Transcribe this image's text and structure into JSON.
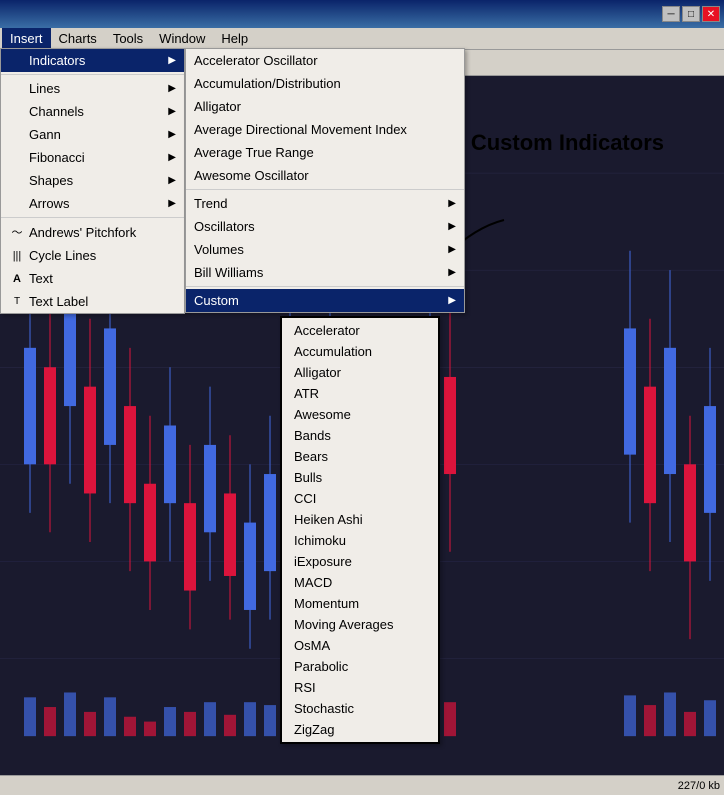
{
  "titlebar": {
    "minimize_label": "─",
    "maximize_label": "□",
    "close_label": "✕"
  },
  "menubar": {
    "items": [
      {
        "label": "Insert",
        "id": "insert",
        "active": true
      },
      {
        "label": "Charts",
        "id": "charts"
      },
      {
        "label": "Tools",
        "id": "tools"
      },
      {
        "label": "Window",
        "id": "window"
      },
      {
        "label": "Help",
        "id": "help"
      }
    ]
  },
  "insert_menu": {
    "items": [
      {
        "label": "Indicators",
        "id": "indicators",
        "has_arrow": true,
        "active": true
      },
      {
        "label": "Lines",
        "id": "lines",
        "has_arrow": true
      },
      {
        "label": "Channels",
        "id": "channels",
        "has_arrow": true
      },
      {
        "label": "Gann",
        "id": "gann",
        "has_arrow": true
      },
      {
        "label": "Fibonacci",
        "id": "fibonacci",
        "has_arrow": true
      },
      {
        "label": "Shapes",
        "id": "shapes",
        "has_arrow": true
      },
      {
        "label": "Arrows",
        "id": "arrows",
        "has_arrow": true
      },
      {
        "sep": true
      },
      {
        "label": "Andrews' Pitchfork",
        "id": "pitchfork",
        "icon": "~"
      },
      {
        "label": "Cycle Lines",
        "id": "cycle",
        "icon": "|||"
      },
      {
        "label": "Text",
        "id": "text",
        "icon": "A"
      },
      {
        "label": "Text Label",
        "id": "textlabel",
        "icon": "T"
      }
    ]
  },
  "indicators_menu": {
    "items": [
      {
        "label": "Accelerator Oscillator",
        "id": "accel"
      },
      {
        "label": "Accumulation/Distribution",
        "id": "accum"
      },
      {
        "label": "Alligator",
        "id": "alligator"
      },
      {
        "label": "Average Directional Movement Index",
        "id": "admi"
      },
      {
        "label": "Average True Range",
        "id": "atr"
      },
      {
        "label": "Awesome Oscillator",
        "id": "awesome"
      },
      {
        "sep": true
      },
      {
        "label": "Trend",
        "id": "trend",
        "has_arrow": true
      },
      {
        "label": "Oscillators",
        "id": "oscillators",
        "has_arrow": true
      },
      {
        "label": "Volumes",
        "id": "volumes",
        "has_arrow": true
      },
      {
        "label": "Bill Williams",
        "id": "bill",
        "has_arrow": true
      },
      {
        "sep": true
      },
      {
        "label": "Custom",
        "id": "custom",
        "has_arrow": true,
        "active": true
      }
    ]
  },
  "custom_menu": {
    "items": [
      {
        "label": "Accelerator",
        "id": "c_accel"
      },
      {
        "label": "Accumulation",
        "id": "c_accum"
      },
      {
        "label": "Alligator",
        "id": "c_allig"
      },
      {
        "label": "ATR",
        "id": "c_atr"
      },
      {
        "label": "Awesome",
        "id": "c_awesome"
      },
      {
        "label": "Bands",
        "id": "c_bands"
      },
      {
        "label": "Bears",
        "id": "c_bears"
      },
      {
        "label": "Bulls",
        "id": "c_bulls"
      },
      {
        "label": "CCI",
        "id": "c_cci"
      },
      {
        "label": "Heiken Ashi",
        "id": "c_heiken"
      },
      {
        "label": "Ichimoku",
        "id": "c_ichimoku"
      },
      {
        "label": "iExposure",
        "id": "c_iexposure"
      },
      {
        "label": "MACD",
        "id": "c_macd"
      },
      {
        "label": "Momentum",
        "id": "c_momentum"
      },
      {
        "label": "Moving Averages",
        "id": "c_ma"
      },
      {
        "label": "OsMA",
        "id": "c_osma"
      },
      {
        "label": "Parabolic",
        "id": "c_parabolic"
      },
      {
        "label": "RSI",
        "id": "c_rsi"
      },
      {
        "label": "Stochastic",
        "id": "c_stoch"
      },
      {
        "label": "ZigZag",
        "id": "c_zigzag"
      }
    ]
  },
  "custom_indicators_label": "Custom Indicators",
  "status_bar": {
    "text": "227/0 kb"
  }
}
